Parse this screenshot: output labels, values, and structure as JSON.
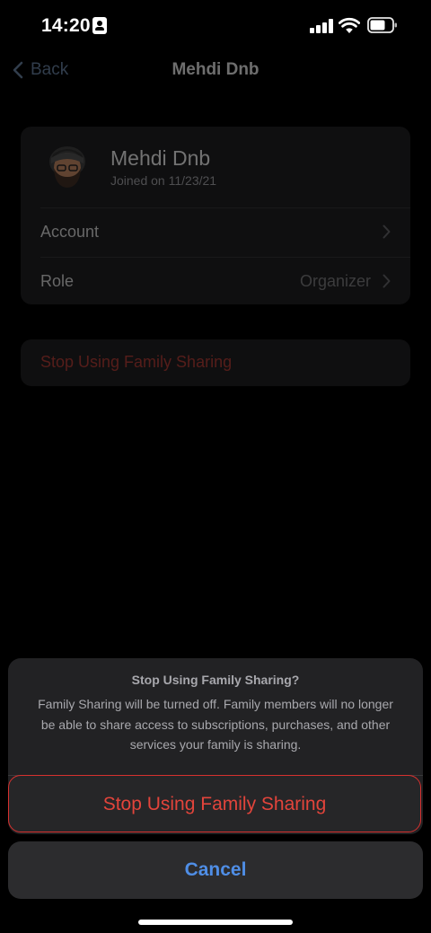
{
  "status_bar": {
    "time": "14:20",
    "icons": [
      "id-card-icon",
      "cellular-signal-icon",
      "wifi-icon",
      "battery-icon"
    ]
  },
  "nav": {
    "back_label": "Back",
    "title": "Mehdi Dnb"
  },
  "profile": {
    "name": "Mehdi Dnb",
    "joined": "Joined on 11/23/21",
    "rows": [
      {
        "label": "Account",
        "value": ""
      },
      {
        "label": "Role",
        "value": "Organizer"
      }
    ]
  },
  "stop_row": {
    "label": "Stop Using Family Sharing"
  },
  "action_sheet": {
    "title": "Stop Using Family Sharing?",
    "message": "Family Sharing will be turned off. Family members will no longer be able to share access to subscriptions, purchases, and other services your family is sharing.",
    "destructive_label": "Stop Using Family Sharing",
    "cancel_label": "Cancel"
  },
  "colors": {
    "background": "#000000",
    "destructive": "#e2443b",
    "cancel": "#4f8ee6",
    "card": "#1c1c1e"
  }
}
